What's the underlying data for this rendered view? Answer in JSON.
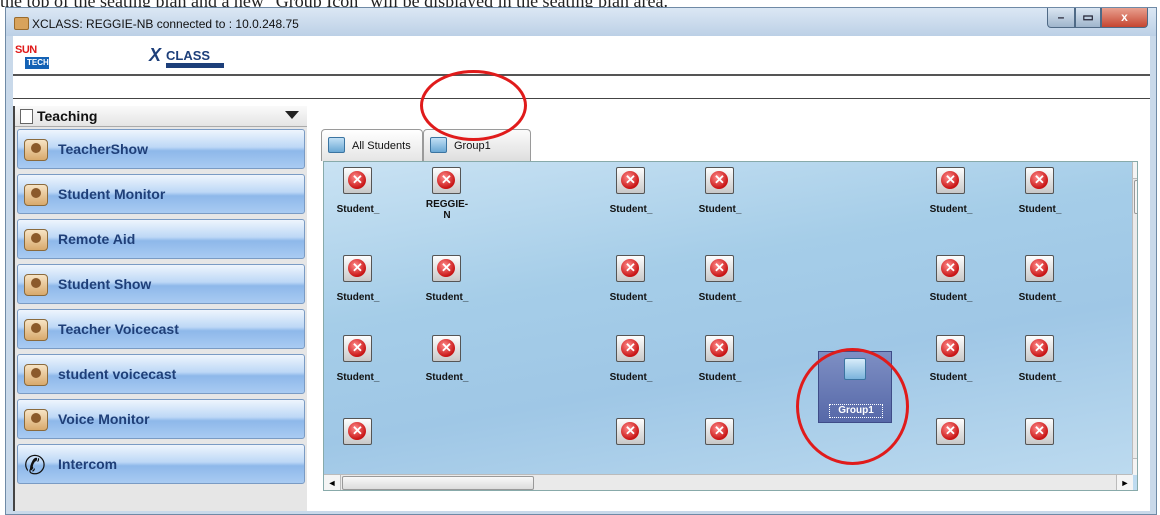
{
  "document": {
    "text_above": "the top of the seating plan and a new \"Group Icon\" will be displayed in the seating plan area."
  },
  "window": {
    "title": "XCLASS: REGGIE-NB connected to : 10.0.248.75",
    "controls": {
      "minimize": "–",
      "maximize": "▭",
      "close": "x"
    }
  },
  "logos": {
    "sun_top": "SUN",
    "sun_bottom": "TECH",
    "xclass_x": "X",
    "xclass_text": "CLASS"
  },
  "sidebar": {
    "header": "Teaching",
    "items": [
      {
        "label": "TeacherShow",
        "icon": "teacher-show-icon"
      },
      {
        "label": "Student Monitor",
        "icon": "monitor-icon"
      },
      {
        "label": "Remote Aid",
        "icon": "remote-aid-icon"
      },
      {
        "label": "Student Show",
        "icon": "student-show-icon"
      },
      {
        "label": "Teacher Voicecast",
        "icon": "teacher-voicecast-icon"
      },
      {
        "label": "student voicecast",
        "icon": "student-voicecast-icon"
      },
      {
        "label": "Voice Monitor",
        "icon": "headset-icon"
      },
      {
        "label": "Intercom",
        "icon": "phone-icon"
      }
    ]
  },
  "tabs": [
    {
      "label": "All Students"
    },
    {
      "label": "Group1"
    }
  ],
  "seats": [
    {
      "name": "Student_"
    },
    {
      "name": "REGGIE-N"
    },
    {
      "name": "Student_"
    },
    {
      "name": "Student_"
    },
    {
      "name": "Student_"
    },
    {
      "name": "Student_"
    },
    {
      "name": "Student_"
    },
    {
      "name": "Student_"
    },
    {
      "name": "Student_"
    },
    {
      "name": "Student_"
    },
    {
      "name": "Student_"
    },
    {
      "name": "Student_"
    },
    {
      "name": "Student_"
    },
    {
      "name": "Student_"
    },
    {
      "name": "Student_"
    },
    {
      "name": "Student_"
    },
    {
      "name": "Student_"
    },
    {
      "name": "Student_"
    },
    {
      "name": ""
    },
    {
      "name": ""
    },
    {
      "name": ""
    },
    {
      "name": ""
    },
    {
      "name": ""
    }
  ],
  "group_icon": {
    "label": "Group1"
  },
  "scroll": {
    "up": "▲",
    "down": "▼",
    "left": "◄",
    "right": "►"
  }
}
